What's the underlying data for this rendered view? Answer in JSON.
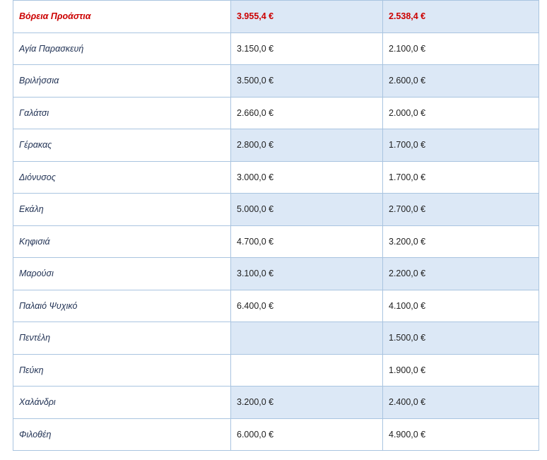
{
  "table": {
    "header": {
      "area": "Βόρεια Προάστια",
      "price1": "3.955,4 €",
      "price2": "2.538,4 €"
    },
    "rows": [
      {
        "area": "Αγία Παρασκευή",
        "price1": "3.150,0 €",
        "price2": "2.100,0 €"
      },
      {
        "area": "Βριλήσσια",
        "price1": "3.500,0 €",
        "price2": "2.600,0 €"
      },
      {
        "area": "Γαλάτσι",
        "price1": "2.660,0 €",
        "price2": "2.000,0 €"
      },
      {
        "area": "Γέρακας",
        "price1": "2.800,0 €",
        "price2": "1.700,0 €"
      },
      {
        "area": "Διόνυσος",
        "price1": "3.000,0 €",
        "price2": "1.700,0 €"
      },
      {
        "area": "Εκάλη",
        "price1": "5.000,0 €",
        "price2": "2.700,0 €"
      },
      {
        "area": "Κηφισιά",
        "price1": "4.700,0 €",
        "price2": "3.200,0 €"
      },
      {
        "area": "Μαρούσι",
        "price1": "3.100,0 €",
        "price2": "2.200,0 €"
      },
      {
        "area": "Παλαιό Ψυχικό",
        "price1": "6.400,0 €",
        "price2": "4.100,0 €"
      },
      {
        "area": "Πεντέλη",
        "price1": "",
        "price2": "1.500,0 €"
      },
      {
        "area": "Πεύκη",
        "price1": "",
        "price2": "1.900,0 €"
      },
      {
        "area": "Χαλάνδρι",
        "price1": "3.200,0 €",
        "price2": "2.400,0 €"
      },
      {
        "area": "Φιλοθέη",
        "price1": "6.000,0 €",
        "price2": "4.900,0 €"
      }
    ]
  },
  "colors": {
    "header_text": "#cc0000",
    "shaded_cell": "#dce8f6",
    "border": "#a9c4e0"
  }
}
